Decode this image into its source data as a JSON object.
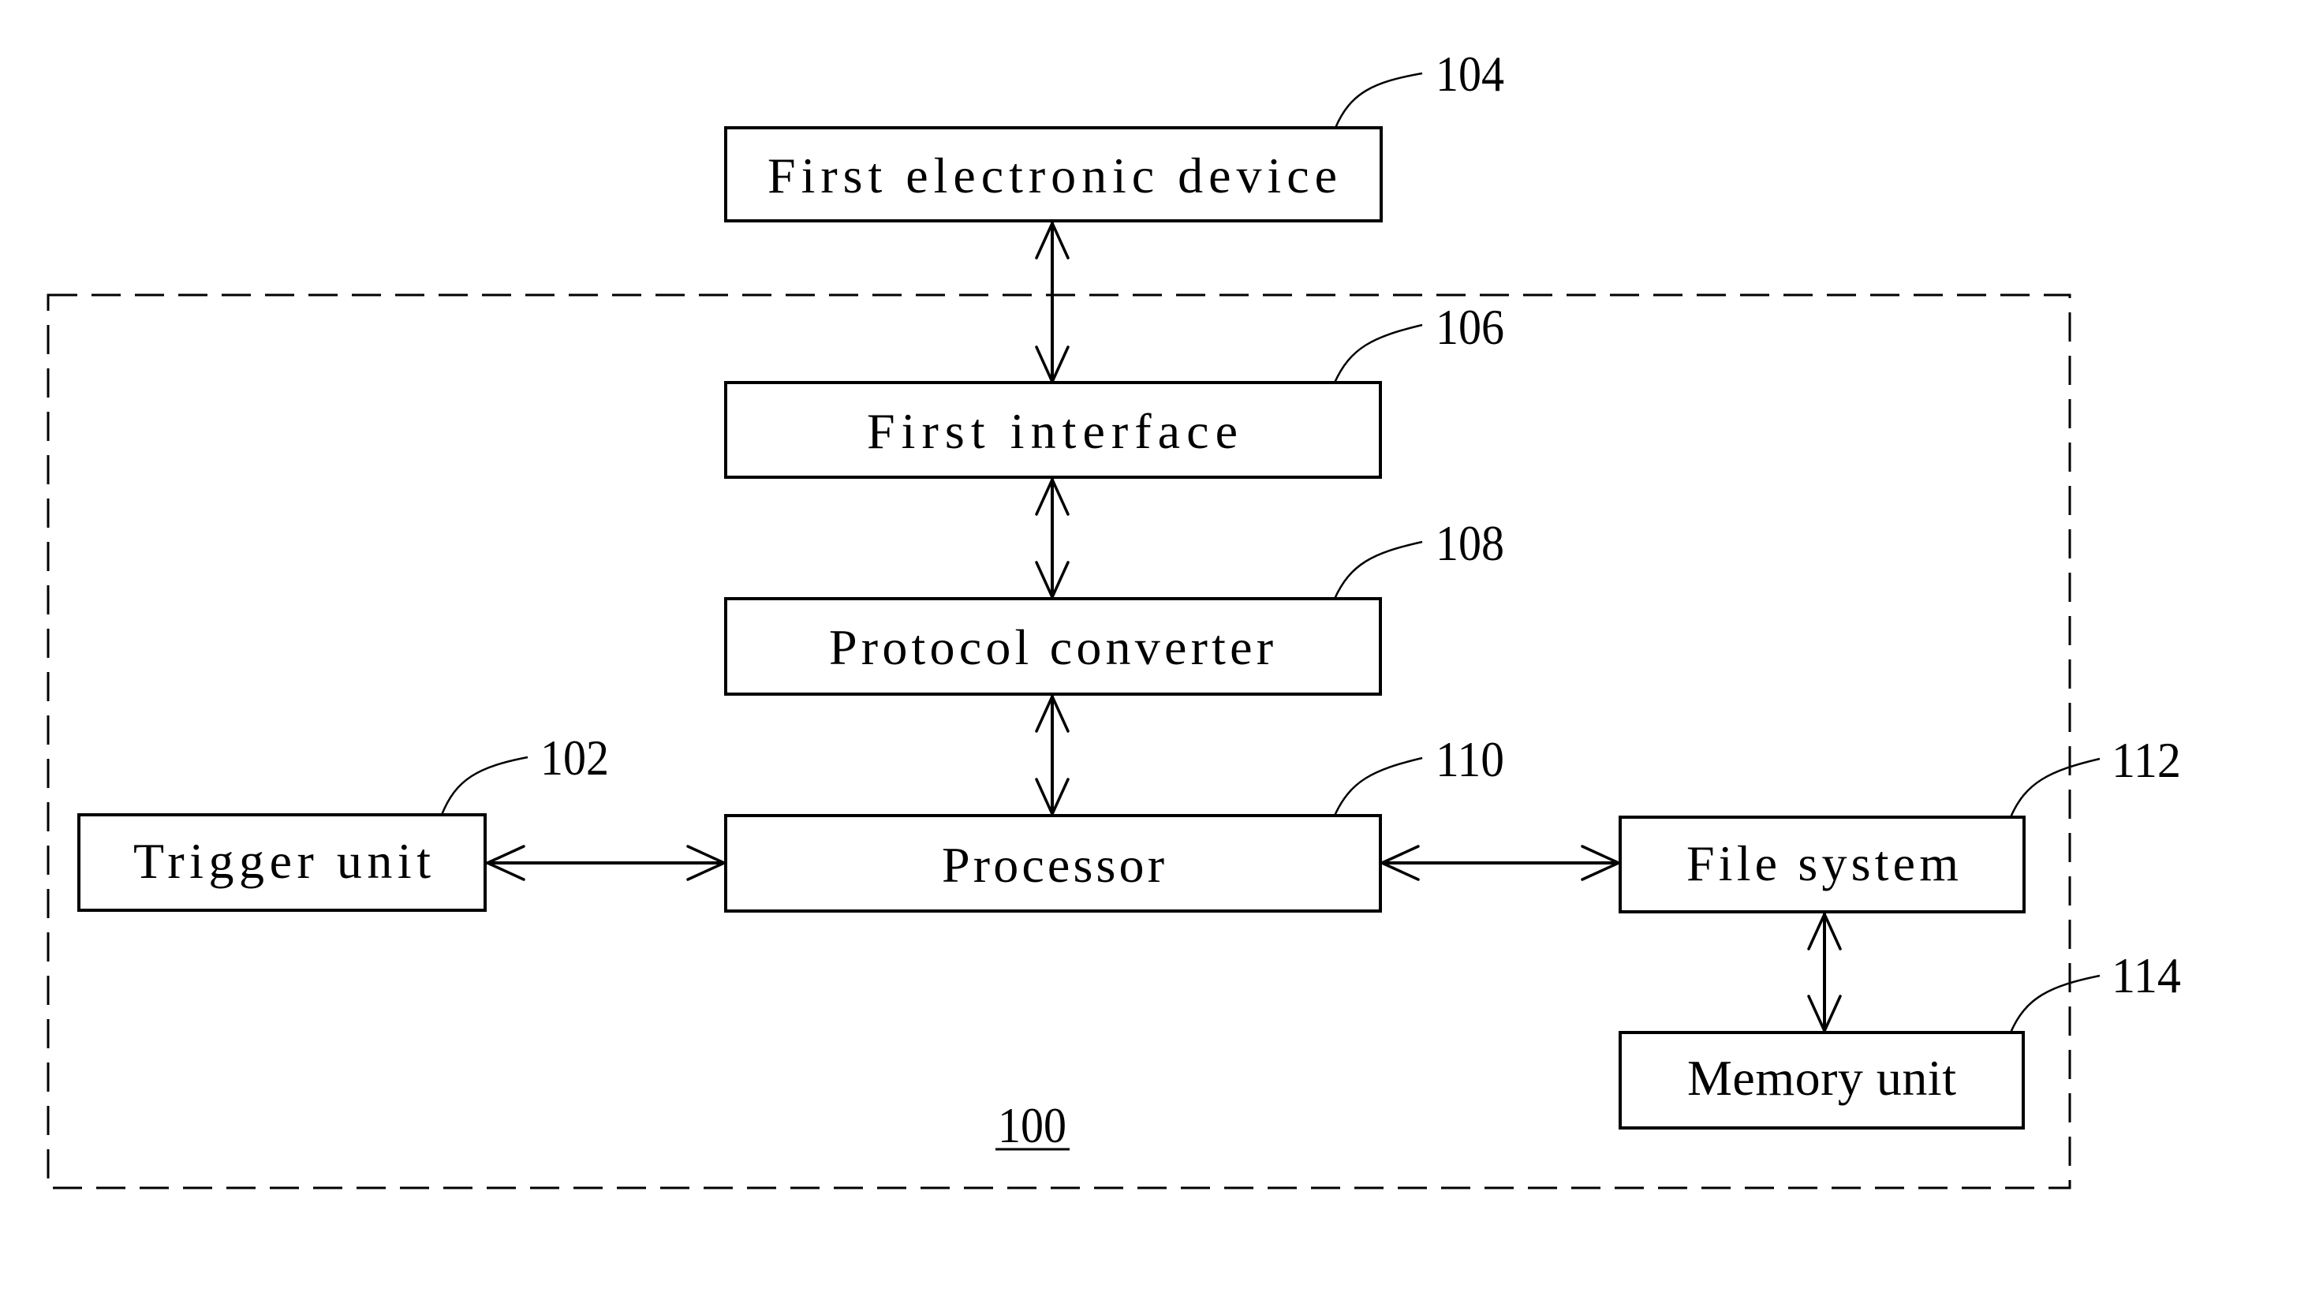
{
  "figure": {
    "type": "block-diagram",
    "container": {
      "ref": "100"
    },
    "blocks": [
      {
        "id": "104",
        "label": "First electronic device",
        "inside_container": false
      },
      {
        "id": "106",
        "label": "First interface",
        "inside_container": true
      },
      {
        "id": "108",
        "label": "Protocol converter",
        "inside_container": true
      },
      {
        "id": "110",
        "label": "Processor",
        "inside_container": true
      },
      {
        "id": "102",
        "label": "Trigger unit",
        "inside_container": true
      },
      {
        "id": "112",
        "label": "File system",
        "inside_container": true
      },
      {
        "id": "114",
        "label": "Memory unit",
        "inside_container": true
      }
    ],
    "connections": [
      {
        "from": "104",
        "to": "106",
        "direction": "bidirectional"
      },
      {
        "from": "106",
        "to": "108",
        "direction": "bidirectional"
      },
      {
        "from": "108",
        "to": "110",
        "direction": "bidirectional"
      },
      {
        "from": "102",
        "to": "110",
        "direction": "bidirectional"
      },
      {
        "from": "110",
        "to": "112",
        "direction": "bidirectional"
      },
      {
        "from": "112",
        "to": "114",
        "direction": "bidirectional"
      }
    ]
  },
  "labels": {
    "first_electronic_device": "First electronic device",
    "first_interface": "First interface",
    "protocol_converter": "Protocol converter",
    "processor": "Processor",
    "trigger_unit": "Trigger unit",
    "file_system": "File system",
    "memory_unit": "Memory unit"
  },
  "refs": {
    "r100": "100",
    "r102": "102",
    "r104": "104",
    "r106": "106",
    "r108": "108",
    "r110": "110",
    "r112": "112",
    "r114": "114"
  }
}
